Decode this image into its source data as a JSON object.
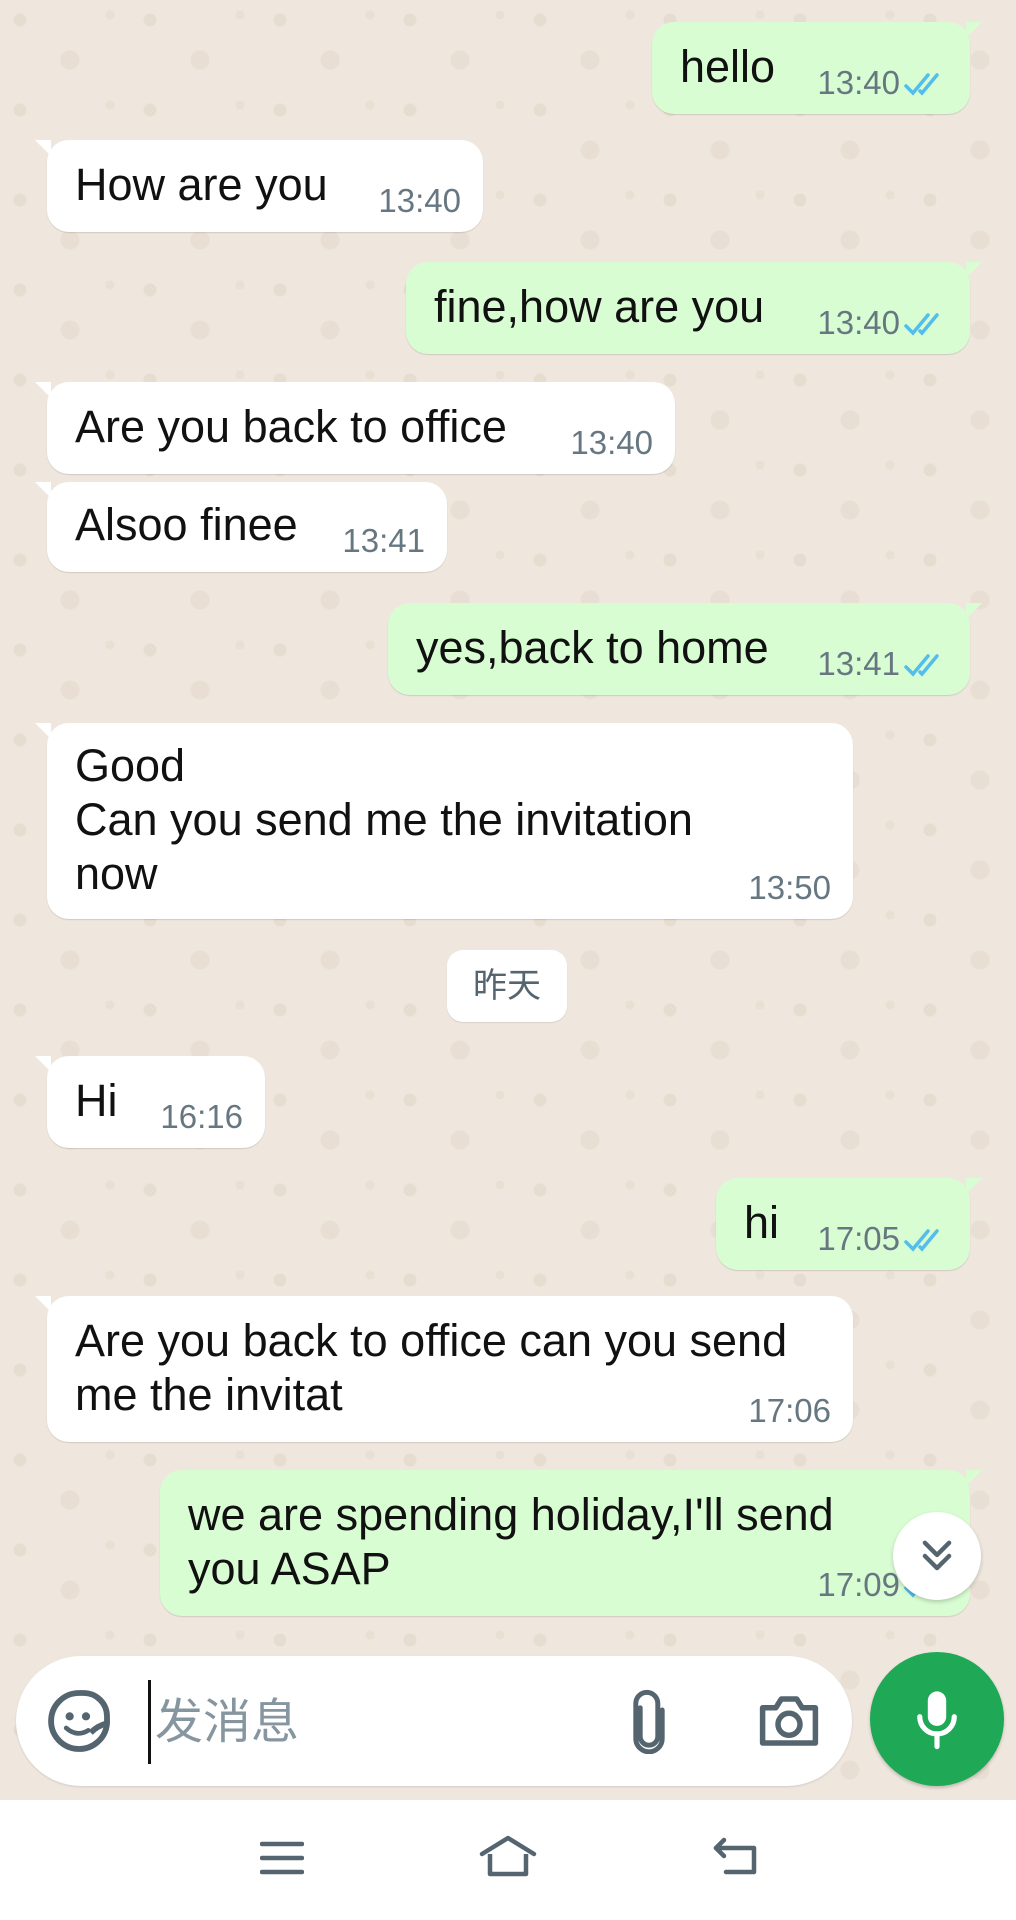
{
  "messages": [
    {
      "dir": "out",
      "text": "hello",
      "time": "13:40",
      "ticks": true
    },
    {
      "dir": "in",
      "text": "How are you",
      "time": "13:40"
    },
    {
      "dir": "out",
      "text": "fine,how are you",
      "time": "13:40",
      "ticks": true
    },
    {
      "dir": "in",
      "text": "Are you back to office",
      "time": "13:40"
    },
    {
      "dir": "in",
      "text": "Alsoo finee",
      "time": "13:41"
    },
    {
      "dir": "out",
      "text": "yes,back to home",
      "time": "13:41",
      "ticks": true
    },
    {
      "dir": "in",
      "text": "Good\nCan you send me the invitation\nnow",
      "time": "13:50"
    },
    {
      "dir": "in",
      "text": "Hi",
      "time": "16:16"
    },
    {
      "dir": "out",
      "text": "hi",
      "time": "17:05",
      "ticks": true
    },
    {
      "dir": "in",
      "text": "Are you back to office can you send\nme the invitat",
      "time": "17:06"
    },
    {
      "dir": "out",
      "text": "we are spending holiday,I'll send\nyou ASAP",
      "time": "17:09",
      "ticks": true
    }
  ],
  "date_divider": "昨天",
  "composer": {
    "placeholder": "发消息",
    "value": ""
  },
  "colors": {
    "background": "#efe7dd",
    "incoming_bubble": "#ffffff",
    "outgoing_bubble": "#d9fdd3",
    "read_ticks": "#53bdeb",
    "mic_button": "#1fa855",
    "timestamp": "#667781"
  },
  "icons": {
    "composer_left": "sticker-icon",
    "attach": "paperclip-icon",
    "camera": "camera-icon",
    "mic": "microphone-icon",
    "scroll_down": "double-chevron-down-icon",
    "nav_menu": "menu-icon",
    "nav_home": "home-icon",
    "nav_back": "back-icon"
  }
}
